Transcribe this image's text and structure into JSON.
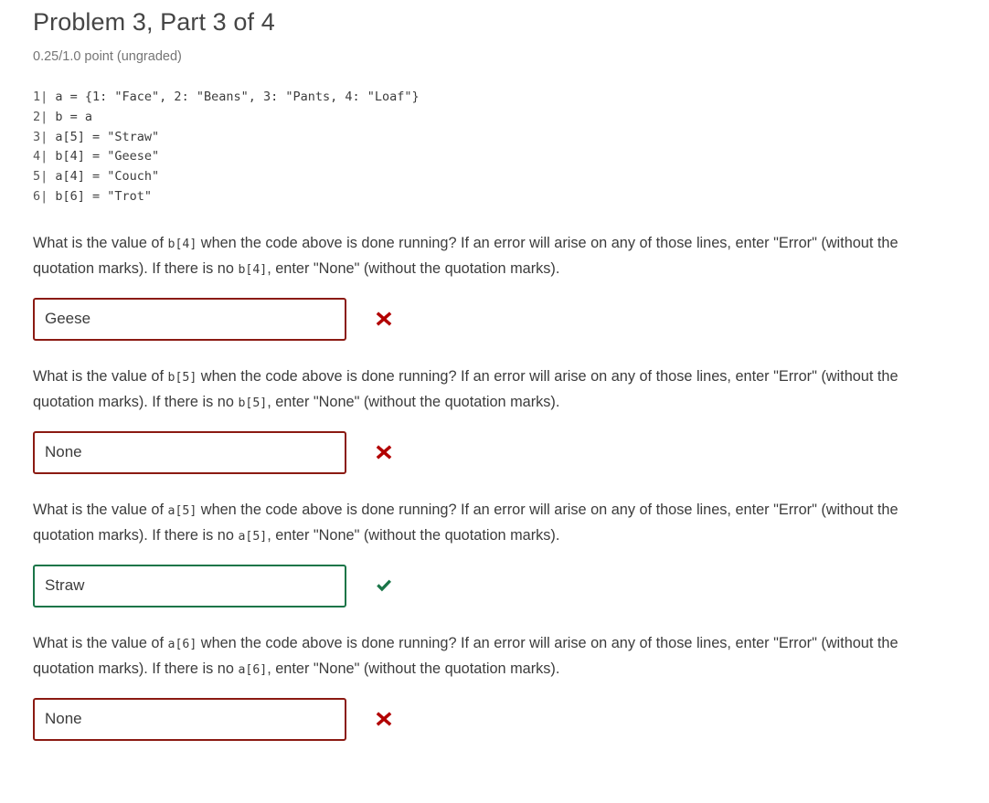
{
  "header": {
    "title": "Problem 3, Part 3 of 4",
    "points_status": "0.25/1.0 point (ungraded)"
  },
  "code": {
    "lines": [
      {
        "number": "1|",
        "text": " a = {1: \"Face\", 2: \"Beans\", 3: \"Pants, 4: \"Loaf\"}"
      },
      {
        "number": "2|",
        "text": " b = a"
      },
      {
        "number": "3|",
        "text": " a[5] = \"Straw\""
      },
      {
        "number": "4|",
        "text": " b[4] = \"Geese\""
      },
      {
        "number": "5|",
        "text": " a[4] = \"Couch\""
      },
      {
        "number": "6|",
        "text": " b[6] = \"Trot\""
      }
    ]
  },
  "questions": [
    {
      "prefix": "What is the value of ",
      "var1": "b[4]",
      "middle": " when the code above is done running? If an error will arise on any of those lines, enter \"Error\" (without the quotation marks). If there is no ",
      "var2": "b[4]",
      "suffix": ", enter \"None\" (without the quotation marks).",
      "answer_value": "Geese",
      "result": "incorrect",
      "mark_icon": "cross-icon"
    },
    {
      "prefix": "What is the value of ",
      "var1": "b[5]",
      "middle": " when the code above is done running? If an error will arise on any of those lines, enter \"Error\" (without the quotation marks). If there is no ",
      "var2": "b[5]",
      "suffix": ", enter \"None\" (without the quotation marks).",
      "answer_value": "None",
      "result": "incorrect",
      "mark_icon": "cross-icon"
    },
    {
      "prefix": "What is the value of ",
      "var1": "a[5]",
      "middle": " when the code above is done running? If an error will arise on any of those lines, enter \"Error\" (without the quotation marks). If there is no ",
      "var2": "a[5]",
      "suffix": ", enter \"None\" (without the quotation marks).",
      "answer_value": "Straw",
      "result": "correct",
      "mark_icon": "check-icon"
    },
    {
      "prefix": "What is the value of ",
      "var1": "a[6]",
      "middle": " when the code above is done running? If an error will arise on any of those lines, enter \"Error\" (without the quotation marks). If there is no ",
      "var2": "a[6]",
      "suffix": ", enter \"None\" (without the quotation marks).",
      "answer_value": "None",
      "result": "incorrect",
      "mark_icon": "check-icon"
    }
  ],
  "colors": {
    "incorrect_border": "#8b1a12",
    "incorrect_mark": "#b20000",
    "correct_border": "#1a7548",
    "correct_mark": "#1a7548",
    "title_text": "#454545",
    "body_text": "#3c3c3c",
    "muted_text": "#757575"
  }
}
